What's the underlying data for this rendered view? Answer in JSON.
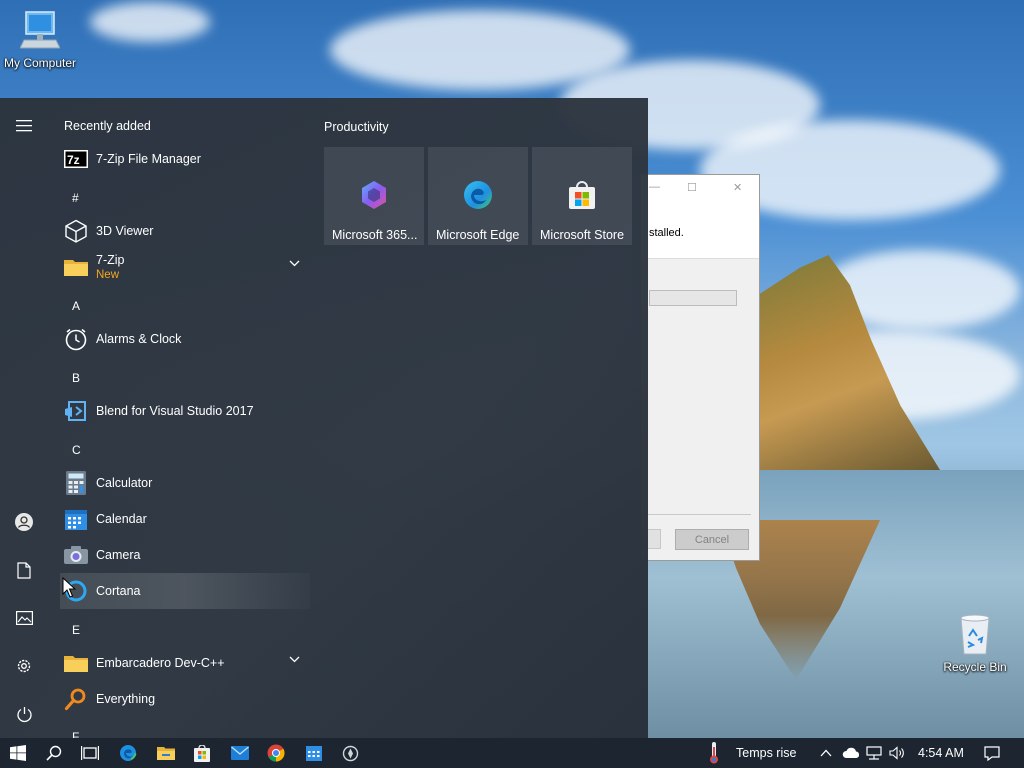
{
  "desktop": {
    "icons": [
      {
        "label": "My Computer"
      },
      {
        "label": "Recycle Bin"
      }
    ]
  },
  "dialog": {
    "message": "stalled.",
    "cancel_label": "Cancel"
  },
  "start_menu": {
    "recently_added_title": "Recently added",
    "recent_app": {
      "label": "7-Zip File Manager",
      "icon": "7zip-icon"
    },
    "sections": [
      {
        "letter": "#"
      },
      {
        "letter": "A"
      },
      {
        "letter": "B"
      },
      {
        "letter": "C"
      },
      {
        "letter": "E"
      },
      {
        "letter": "F"
      }
    ],
    "apps": [
      {
        "label": "3D Viewer",
        "icon": "cube-icon"
      },
      {
        "label": "7-Zip",
        "sublabel": "New",
        "icon": "folder-icon"
      },
      {
        "label": "Alarms & Clock",
        "icon": "clock-icon"
      },
      {
        "label": "Blend for Visual Studio 2017",
        "icon": "blend-icon"
      },
      {
        "label": "Calculator",
        "icon": "calculator-icon"
      },
      {
        "label": "Calendar",
        "icon": "calendar-icon"
      },
      {
        "label": "Camera",
        "icon": "camera-icon"
      },
      {
        "label": "Cortana",
        "icon": "cortana-icon"
      },
      {
        "label": "Embarcadero Dev-C++",
        "icon": "folder-icon"
      },
      {
        "label": "Everything",
        "icon": "magnifier-icon"
      }
    ],
    "tile_group_title": "Productivity",
    "tiles": [
      {
        "label": "Microsoft 365...",
        "icon": "m365-icon"
      },
      {
        "label": "Microsoft Edge",
        "icon": "edge-icon"
      },
      {
        "label": "Microsoft Store",
        "icon": "store-icon"
      }
    ]
  },
  "taskbar": {
    "weather_text": "Temps rise",
    "clock": "4:54 AM"
  },
  "colors": {
    "accent_new": "#f5a623",
    "start_bg": "#2c343e",
    "taskbar_bg": "#1d2530"
  }
}
